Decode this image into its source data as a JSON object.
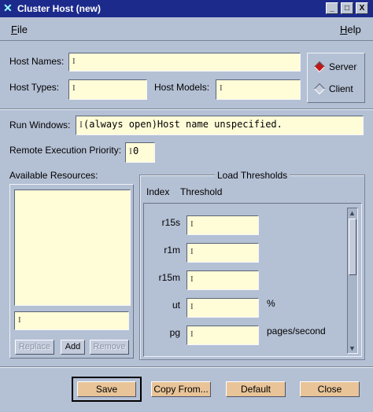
{
  "window": {
    "title": "Cluster Host (new)",
    "minimize_glyph": "_",
    "maximize_glyph": "□",
    "close_glyph": "X"
  },
  "menu": {
    "file_letter": "F",
    "file_rest": "ile",
    "help_letter": "H",
    "help_rest": "elp"
  },
  "form": {
    "host_names_label": "Host Names:",
    "host_names_value": "",
    "host_types_label": "Host Types:",
    "host_types_value": "",
    "host_models_label": "Host Models:",
    "host_models_value": "",
    "run_windows_label": "Run Windows:",
    "run_windows_value": "(always open)Host name unspecified.",
    "priority_label": "Remote Execution Priority:",
    "priority_value": "0"
  },
  "mode": {
    "server_label": "Server",
    "client_label": "Client",
    "selected": "Server"
  },
  "resources": {
    "label": "Available Resources:",
    "input_value": "",
    "replace_label": "Replace",
    "add_label": "Add",
    "remove_label": "Remove"
  },
  "thresholds": {
    "group_title": "Load Thresholds",
    "index_header": "Index",
    "threshold_header": "Threshold",
    "rows": [
      {
        "index": "r15s",
        "value": "",
        "unit": ""
      },
      {
        "index": "r1m",
        "value": "",
        "unit": ""
      },
      {
        "index": "r15m",
        "value": "",
        "unit": ""
      },
      {
        "index": "ut",
        "value": "",
        "unit": "%"
      },
      {
        "index": "pg",
        "value": "",
        "unit": "pages/second"
      }
    ]
  },
  "footer": {
    "save_label": "Save",
    "copy_from_label": "Copy From...",
    "default_label": "Default",
    "close_label": "Close"
  },
  "colors": {
    "background": "#b4c0d4",
    "titlebar": "#1c2a8c",
    "field": "#fffcd8",
    "button": "#e8c498",
    "server_indicator": "#c01818"
  }
}
